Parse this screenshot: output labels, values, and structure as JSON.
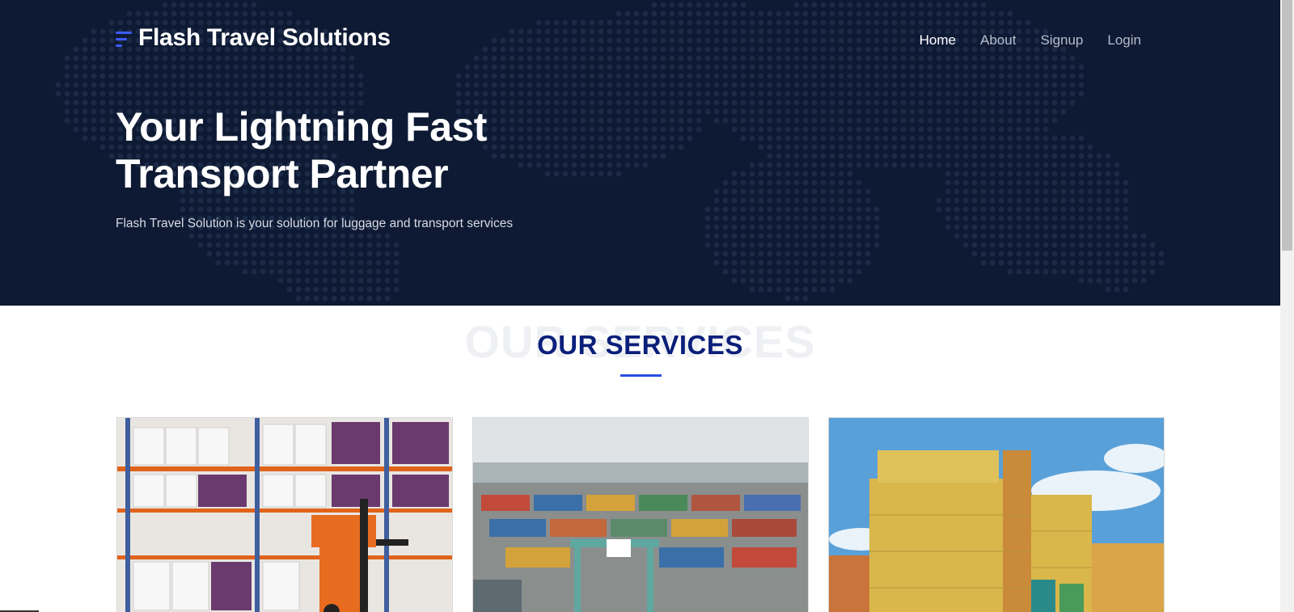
{
  "header": {
    "brand_title": "Flash Travel Solutions",
    "brand_icon": "menu-lines-icon",
    "nav": [
      {
        "label": "Home",
        "active": true
      },
      {
        "label": "About",
        "active": false
      },
      {
        "label": "Signup",
        "active": false
      },
      {
        "label": "Login",
        "active": false
      }
    ]
  },
  "hero": {
    "heading": "Your Lightning Fast Transport Partner",
    "subtitle": "Flash Travel Solution is your solution for luggage and transport services"
  },
  "services": {
    "title": "OUR SERVICES",
    "background_text": "OUR SERVICES",
    "cards": [
      {
        "image": "warehouse-forklift-image"
      },
      {
        "image": "container-port-image"
      },
      {
        "image": "stacked-containers-image"
      }
    ]
  },
  "colors": {
    "hero_bg": "#0e1a33",
    "accent": "#3d5cff",
    "title_blue": "#0a1f7a"
  }
}
